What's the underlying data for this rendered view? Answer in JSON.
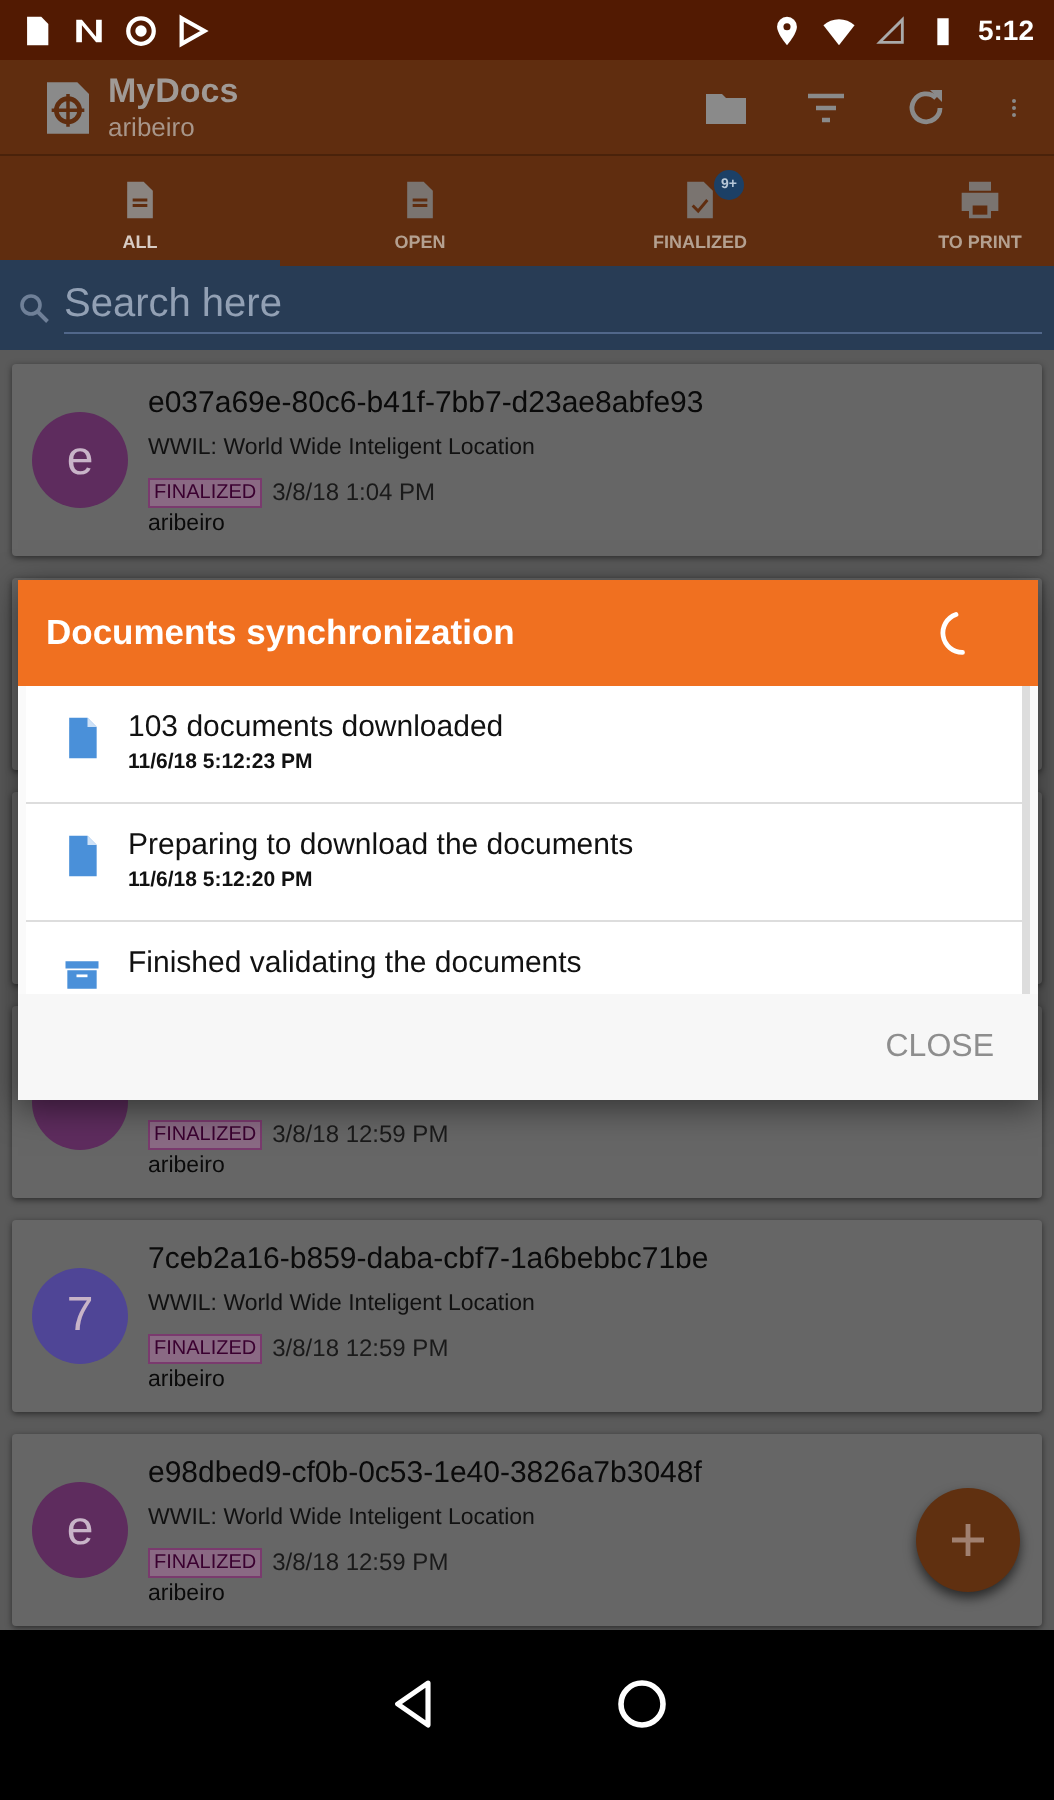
{
  "status_bar": {
    "time": "5:12"
  },
  "app_bar": {
    "title": "MyDocs",
    "subtitle": "aribeiro"
  },
  "tabs": [
    {
      "label": "ALL",
      "kind": "doc",
      "selected": true
    },
    {
      "label": "OPEN",
      "kind": "doc",
      "selected": false
    },
    {
      "label": "FINALIZED",
      "kind": "check",
      "selected": false,
      "badge": "9+"
    },
    {
      "label": "TO PRINT",
      "kind": "print",
      "selected": false
    }
  ],
  "search": {
    "placeholder": "Search here"
  },
  "documents": [
    {
      "avatar": "e",
      "color": "#5e2c5e",
      "title": "e037a69e-80c6-b41f-7bb7-d23ae8abfe93",
      "subtitle": "WWIL: World Wide Inteligent Location",
      "status": "FINALIZED",
      "date": "3/8/18 1:04 PM",
      "user": "aribeiro"
    },
    {
      "color": "#5e2c5e",
      "status": "FINALIZED",
      "date": "3/8/18 12:59 PM",
      "user": "aribeiro"
    },
    {
      "avatar": "7",
      "color": "#4f4596",
      "title": "7ceb2a16-b859-daba-cbf7-1a6bebbc71be",
      "subtitle": "WWIL: World Wide Inteligent Location",
      "status": "FINALIZED",
      "date": "3/8/18 12:59 PM",
      "user": "aribeiro"
    },
    {
      "avatar": "e",
      "color": "#5e2c5e",
      "title": "e98dbed9-cf0b-0c53-1e40-3826a7b3048f",
      "subtitle": "WWIL: World Wide Inteligent Location",
      "status": "FINALIZED",
      "date": "3/8/18 12:59 PM",
      "user": "aribeiro"
    }
  ],
  "dialog": {
    "title": "Documents synchronization",
    "entries": [
      {
        "kind": "file",
        "text": "103 documents downloaded",
        "time": "11/6/18 5:12:23 PM"
      },
      {
        "kind": "file",
        "text": "Preparing to download the documents",
        "time": "11/6/18 5:12:20 PM"
      },
      {
        "kind": "box",
        "text": "Finished validating the documents"
      }
    ],
    "close": {
      "label": "CLOSE",
      "disabled": true
    }
  }
}
